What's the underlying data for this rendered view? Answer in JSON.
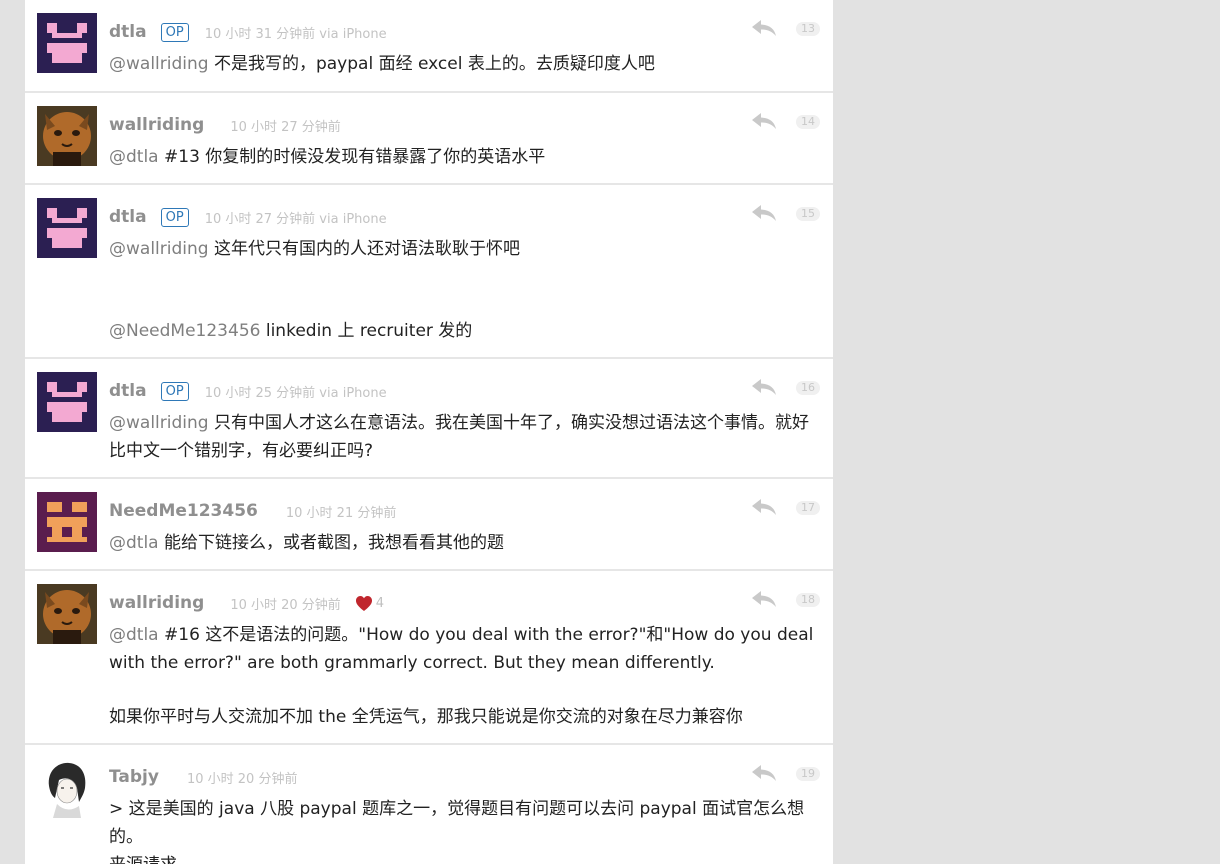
{
  "colors": {
    "op": "#2e78b7",
    "mention": "#7f7f7f",
    "text": "#222222",
    "meta": "#c3c3c3"
  },
  "replies": [
    {
      "username": "dtla",
      "op": "OP",
      "time": "10 小时 31 分钟前 via iPhone",
      "floor": "13",
      "lines": [
        [
          "@wallriding",
          " 不是我写的，paypal 面经 excel 表上的。去质疑印度人吧"
        ]
      ]
    },
    {
      "username": "wallriding",
      "time": "10 小时 27 分钟前",
      "floor": "14",
      "lines": [
        [
          "@dtla",
          " #13 你复制的时候没发现有错暴露了你的英语水平"
        ]
      ]
    },
    {
      "username": "dtla",
      "op": "OP",
      "time": "10 小时 27 分钟前 via iPhone",
      "floor": "15",
      "lines": [
        [
          "@wallriding",
          " 这年代只有国内的人还对语法耿耿于怀吧"
        ],
        [
          "@NeedMe123456",
          " linkedin 上 recruiter 发的"
        ]
      ]
    },
    {
      "username": "dtla",
      "op": "OP",
      "time": "10 小时 25 分钟前 via iPhone",
      "floor": "16",
      "lines": [
        [
          "@wallriding",
          " 只有中国人才这么在意语法。我在美国十年了，确实没想过语法这个事情。就好比中文一个错别字，有必要纠正吗?"
        ]
      ]
    },
    {
      "username": "NeedMe123456",
      "time": "10 小时 21 分钟前",
      "floor": "17",
      "lines": [
        [
          "@dtla",
          " 能给下链接么，或者截图，我想看看其他的题"
        ]
      ]
    },
    {
      "username": "wallriding",
      "time": "10 小时 20 分钟前",
      "thanks": "4",
      "floor": "18",
      "lines": [
        [
          "@dtla",
          " #16 这不是语法的问题。\"How do you deal with the error?\"和\"How do you deal with the error?\" are both grammarly correct. But they mean differently."
        ],
        [
          "",
          "如果你平时与人交流加不加 the 全凭运气，那我只能说是你交流的对象在尽力兼容你"
        ]
      ]
    },
    {
      "username": "Tabjy",
      "time": "10 小时 20 分钟前",
      "floor": "19",
      "lines": [
        [
          "",
          "> 这是美国的 java 八股 paypal 题库之一，觉得题目有问题可以去问 paypal 面试官怎么想的。"
        ],
        [
          "",
          "来源请求"
        ]
      ]
    }
  ]
}
